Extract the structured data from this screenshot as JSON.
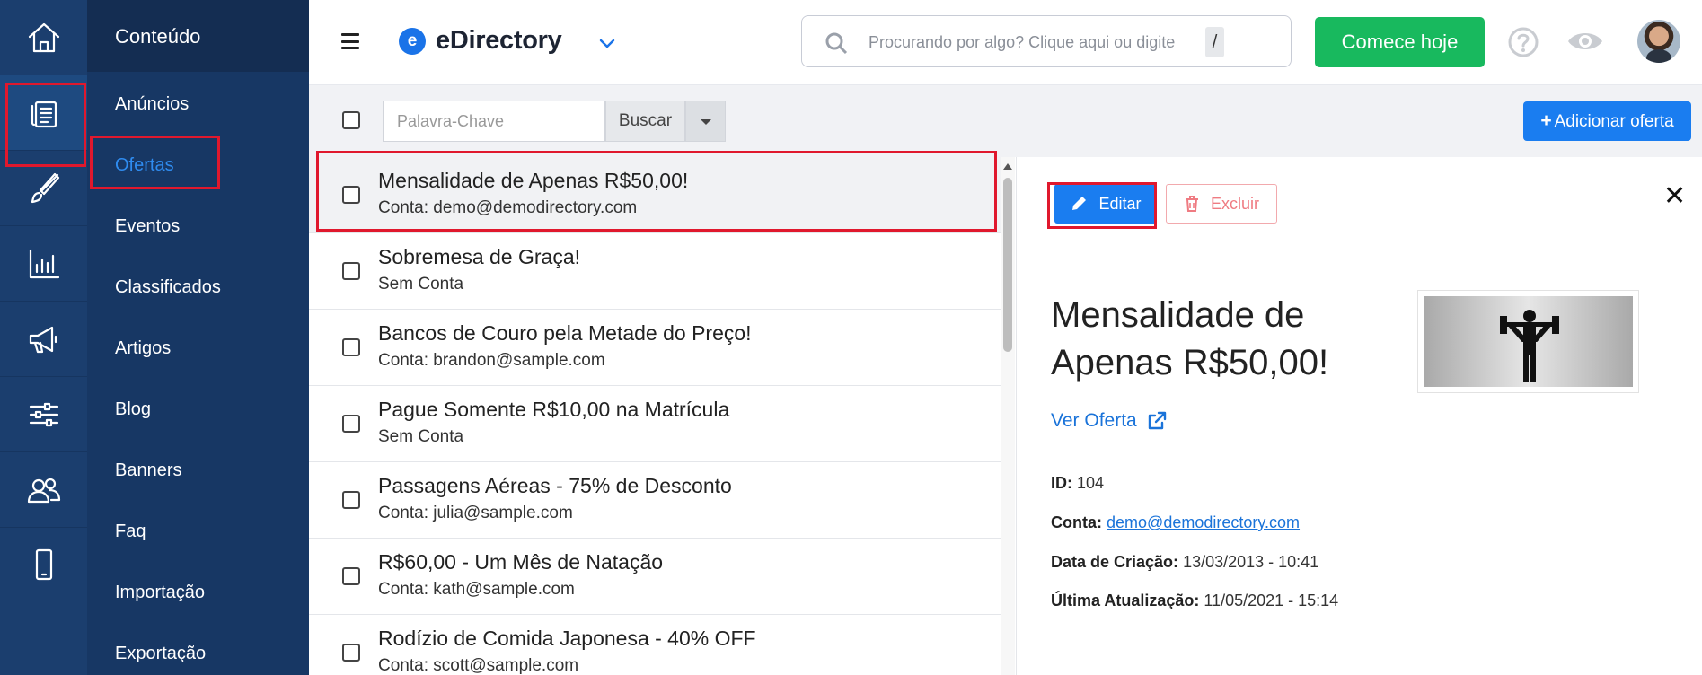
{
  "rail": {
    "items": [
      {
        "name": "home-icon"
      },
      {
        "name": "content-icon"
      },
      {
        "name": "design-brush-icon"
      },
      {
        "name": "reports-chart-icon"
      },
      {
        "name": "promote-megaphone-icon"
      },
      {
        "name": "settings-sliders-icon"
      },
      {
        "name": "users-icon"
      },
      {
        "name": "mobile-icon"
      }
    ],
    "active_index": 1
  },
  "subnav": {
    "heading": "Conteúdo",
    "items": [
      {
        "label": "Anúncios"
      },
      {
        "label": "Ofertas"
      },
      {
        "label": "Eventos"
      },
      {
        "label": "Classificados"
      },
      {
        "label": "Artigos"
      },
      {
        "label": "Blog"
      },
      {
        "label": "Banners"
      },
      {
        "label": "Faq"
      },
      {
        "label": "Importação"
      },
      {
        "label": "Exportação"
      }
    ],
    "active_label": "Ofertas"
  },
  "topbar": {
    "brand_letter": "e",
    "brand_name": "eDirectory",
    "search_placeholder": "Procurando por algo? Clique aqui ou digite",
    "search_shortcut": "/",
    "cta_label": "Comece hoje"
  },
  "toolbar": {
    "keyword_placeholder": "Palavra-Chave",
    "search_button": "Buscar",
    "add_button": "Adicionar oferta",
    "add_icon": "plus-icon"
  },
  "list": {
    "rows": [
      {
        "title": "Mensalidade de Apenas R$50,00!",
        "subtitle": "Conta: demo@demodirectory.com",
        "selected": true
      },
      {
        "title": "Sobremesa de Graça!",
        "subtitle": "Sem Conta",
        "selected": false
      },
      {
        "title": "Bancos de Couro pela Metade do Preço!",
        "subtitle": "Conta: brandon@sample.com",
        "selected": false
      },
      {
        "title": "Pague Somente R$10,00 na Matrícula",
        "subtitle": "Sem Conta",
        "selected": false
      },
      {
        "title": "Passagens Aéreas - 75% de Desconto",
        "subtitle": "Conta: julia@sample.com",
        "selected": false
      },
      {
        "title": "R$60,00 - Um Mês de Natação",
        "subtitle": "Conta: kath@sample.com",
        "selected": false
      },
      {
        "title": "Rodízio de Comida Japonesa - 40% OFF",
        "subtitle": "Conta: scott@sample.com",
        "selected": false
      }
    ]
  },
  "detail": {
    "edit_label": "Editar",
    "delete_label": "Excluir",
    "close_glyph": "✕",
    "title": "Mensalidade de Apenas R$50,00!",
    "view_link": "Ver Oferta",
    "id_label": "ID:",
    "id_value": "104",
    "account_label": "Conta:",
    "account_value": "demo@demodirectory.com",
    "created_label": "Data de Criação:",
    "created_value": "13/03/2013 - 10:41",
    "updated_label": "Última Atualização:",
    "updated_value": "11/05/2021 - 15:14",
    "image_icon": "weightlifter-icon"
  },
  "colors": {
    "rail_bg": "#1b3e6e",
    "subnav_bg": "#173764",
    "accent_blue": "#1a7df0",
    "cta_green": "#18b95e",
    "highlight_red": "#e0182d",
    "delete_red": "#ef7b82"
  }
}
